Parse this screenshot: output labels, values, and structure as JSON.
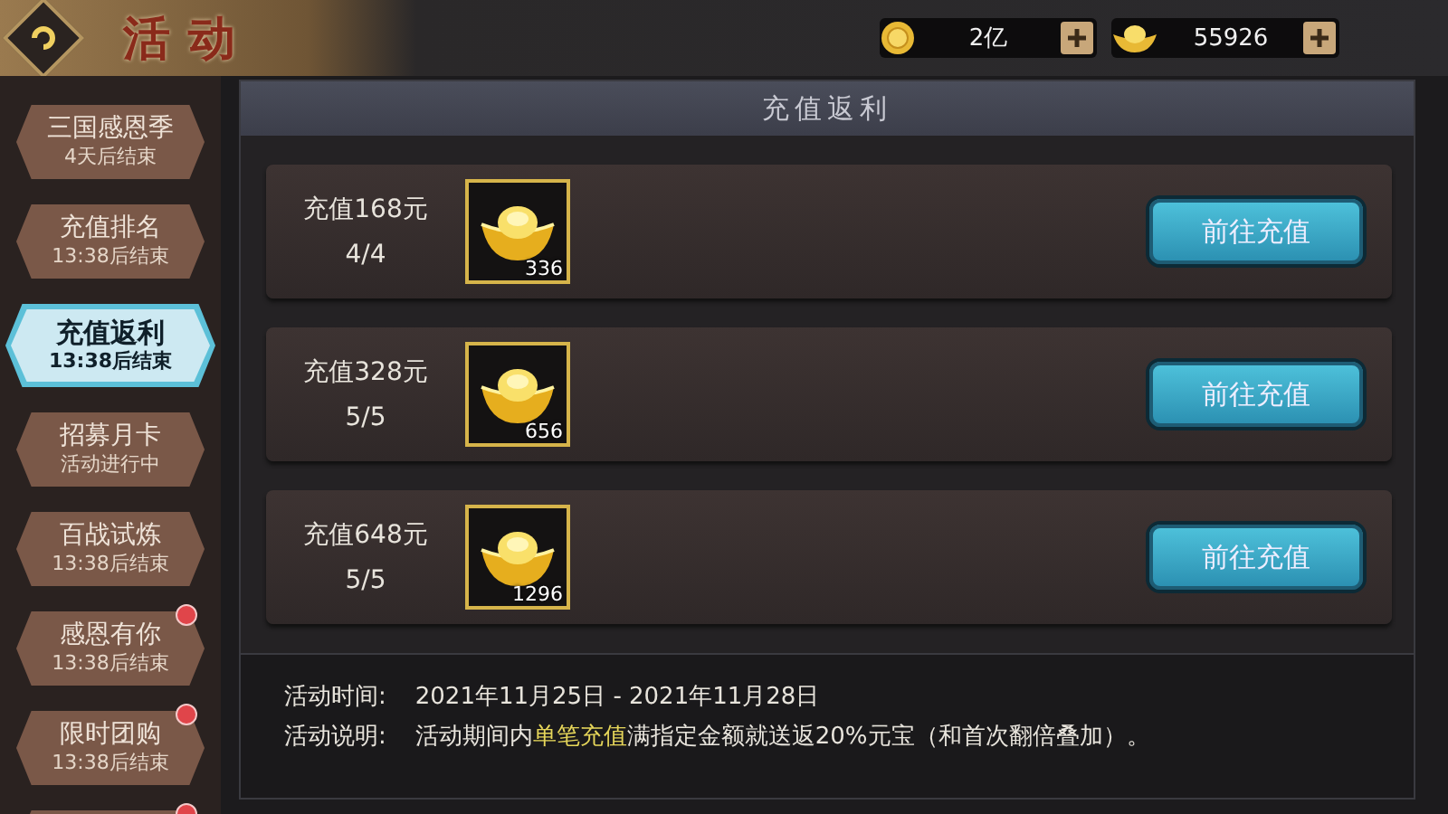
{
  "header": {
    "title": "活动"
  },
  "currencies": [
    {
      "kind": "coin",
      "value": "2亿"
    },
    {
      "kind": "ingot",
      "value": "55926"
    }
  ],
  "sidebar": {
    "items": [
      {
        "label": "三国感恩季",
        "sub": "4天后结束",
        "selected": false,
        "badge": false
      },
      {
        "label": "充值排名",
        "sub": "13:38后结束",
        "selected": false,
        "badge": false
      },
      {
        "label": "充值返利",
        "sub": "13:38后结束",
        "selected": true,
        "badge": false
      },
      {
        "label": "招募月卡",
        "sub": "活动进行中",
        "selected": false,
        "badge": false
      },
      {
        "label": "百战试炼",
        "sub": "13:38后结束",
        "selected": false,
        "badge": false
      },
      {
        "label": "感恩有你",
        "sub": "13:38后结束",
        "selected": false,
        "badge": true
      },
      {
        "label": "限时团购",
        "sub": "13:38后结束",
        "selected": false,
        "badge": true
      }
    ],
    "partial_item": {
      "badge": true
    }
  },
  "panel": {
    "title": "充值返利",
    "rewards": [
      {
        "label": "充值168元",
        "progress": "4/4",
        "count": "336",
        "button": "前往充值"
      },
      {
        "label": "充值328元",
        "progress": "5/5",
        "count": "656",
        "button": "前往充值"
      },
      {
        "label": "充值648元",
        "progress": "5/5",
        "count": "1296",
        "button": "前往充值"
      }
    ],
    "info": {
      "time_label": "活动时间:",
      "time": "2021年11月25日 - 2021年11月28日",
      "desc_label": "活动说明:",
      "description": [
        {
          "text": "活动期间内",
          "highlight": false
        },
        {
          "text": "单笔充值",
          "highlight": true
        },
        {
          "text": "满指定金额就送返20%元宝（和首次翻倍叠加）。",
          "highlight": false
        }
      ]
    }
  }
}
